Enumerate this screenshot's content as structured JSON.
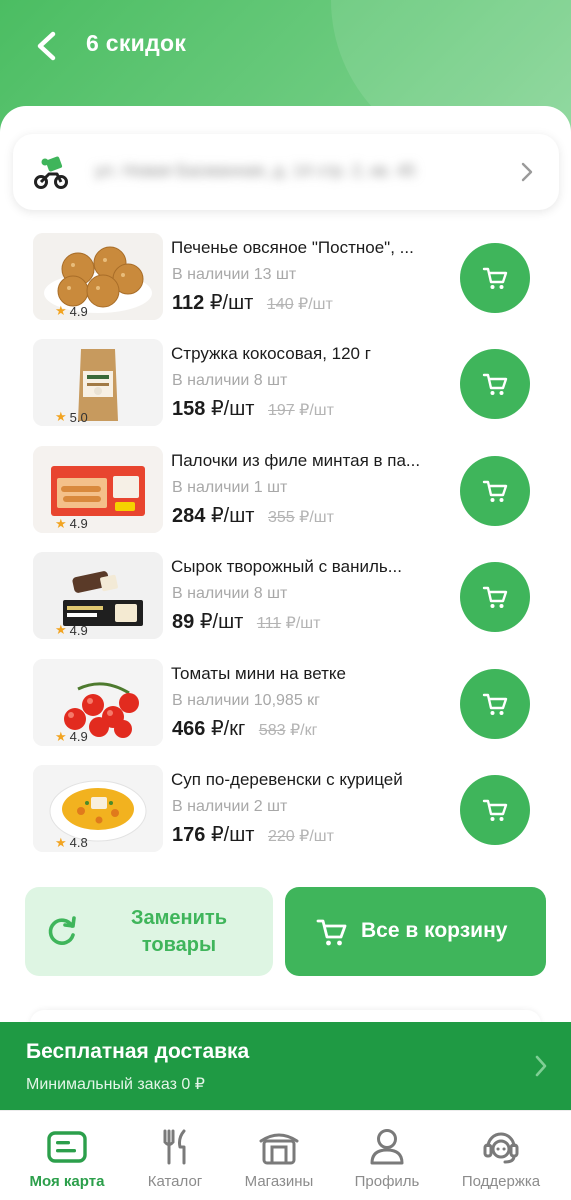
{
  "header": {
    "title": "6 скидок"
  },
  "address": {
    "text": "ул. Новая Басманная, д. 14 стр. 2, кв. 45"
  },
  "products": [
    {
      "name": "Печенье овсяное \"Постное\", ...",
      "stock": "В наличии 13 шт",
      "price": "112",
      "unit": "₽/шт",
      "old_price": "140",
      "old_unit": "₽/шт",
      "rating": "4.9",
      "image": "oat-cookies"
    },
    {
      "name": "Стружка кокосовая, 120 г",
      "stock": "В наличии 8 шт",
      "price": "158",
      "unit": "₽/шт",
      "old_price": "197",
      "old_unit": "₽/шт",
      "rating": "5.0",
      "image": "coconut-flakes-pack"
    },
    {
      "name": "Палочки из филе минтая в па...",
      "stock": "В наличии 1 шт",
      "price": "284",
      "unit": "₽/шт",
      "old_price": "355",
      "old_unit": "₽/шт",
      "rating": "4.9",
      "image": "fish-sticks-box"
    },
    {
      "name": "Сырок творожный с ваниль...",
      "stock": "В наличии 8 шт",
      "price": "89",
      "unit": "₽/шт",
      "old_price": "111",
      "old_unit": "₽/шт",
      "rating": "4.9",
      "image": "curd-snack"
    },
    {
      "name": "Томаты мини на ветке",
      "stock": "В наличии 10,985 кг",
      "price": "466",
      "unit": "₽/кг",
      "old_price": "583",
      "old_unit": "₽/кг",
      "rating": "4.9",
      "image": "cherry-tomatoes"
    },
    {
      "name": "Суп по-деревенски с курицей",
      "stock": "В наличии 2 шт",
      "price": "176",
      "unit": "₽/шт",
      "old_price": "220",
      "old_unit": "₽/шт",
      "rating": "4.8",
      "image": "chicken-soup"
    }
  ],
  "actions": {
    "replace_label": "Заменить товары",
    "all_to_cart_label": "Все в корзину"
  },
  "delivery": {
    "title": "Бесплатная доставка",
    "subtitle": "Минимальный заказ  0 ₽"
  },
  "tabs": [
    {
      "label": "Моя карта",
      "icon": "card-icon",
      "active": true
    },
    {
      "label": "Каталог",
      "icon": "cutlery-icon",
      "active": false
    },
    {
      "label": "Магазины",
      "icon": "store-icon",
      "active": false
    },
    {
      "label": "Профиль",
      "icon": "profile-icon",
      "active": false
    },
    {
      "label": "Поддержка",
      "icon": "support-icon",
      "active": false
    }
  ],
  "colors": {
    "accent": "#3fb55b",
    "header": "#4bbd62",
    "delivery_bar": "#1f9a44",
    "replace_bg": "#def5e3"
  }
}
